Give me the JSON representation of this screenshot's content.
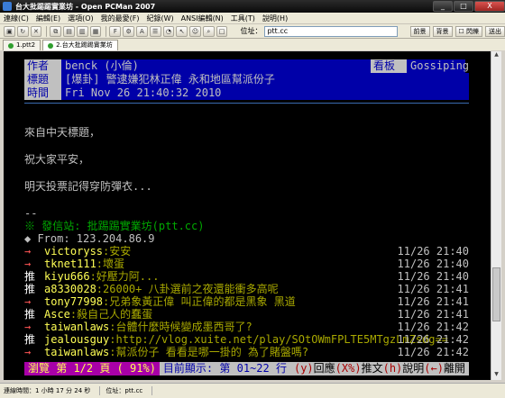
{
  "window": {
    "title": "台大批踢踢實業坊 - Open PCMan 2007",
    "controls": [
      "_",
      "□",
      "X"
    ]
  },
  "menu": [
    "連線(C)",
    "編輯(E)",
    "選項(O)",
    "我的最愛(F)",
    "紀錄(W)",
    "ANSI編輯(N)",
    "工具(T)",
    "說明(H)"
  ],
  "toolbar": {
    "address_label": "位址：",
    "address_value": "ptt.cc",
    "front_label": "前景",
    "back_label": "背景",
    "flash_label": "閃爍",
    "send_label": "送出"
  },
  "tabs": [
    {
      "label": "1.ptt2"
    },
    {
      "label": "2.台大批踢踢實業坊"
    }
  ],
  "article": {
    "author_key": "作者",
    "author": "benck (小倫)",
    "board_key": "看板",
    "board": "Gossiping",
    "title_key": "標題",
    "title": "[爆卦] 警逮嫌犯林正偉 永和地區幫派份子",
    "time_key": "時間",
    "time": "Fri Nov 26 21:40:32 2010",
    "body": [
      "來自中天標題，",
      "祝大家平安，",
      "明天投票記得穿防彈衣..."
    ],
    "signature_dashes": "--",
    "origin_line": "※ 發信站: 批踢踢實業坊(ptt.cc)",
    "from_line": "◆ From: 123.204.86.9"
  },
  "pushes": [
    {
      "tag": "→",
      "user": "victoryss",
      "content": ":安安",
      "time": "11/26 21:40"
    },
    {
      "tag": "→",
      "user": "tknet111",
      "content": ":壞蛋",
      "time": "11/26 21:40"
    },
    {
      "tag": "推",
      "user": "kiyu666",
      "content": ":好壓力阿...",
      "time": "11/26 21:40"
    },
    {
      "tag": "推",
      "user": "a8330028",
      "content": ":26000+ 八卦選前之夜還能衝多高呢",
      "time": "11/26 21:41"
    },
    {
      "tag": "→",
      "user": "tony77998",
      "content": ":兄弟象黃正偉  叫正偉的都是黑象  黑道",
      "time": "11/26 21:41"
    },
    {
      "tag": "推",
      "user": "Asce",
      "content": ":殺自己人的蠢蛋",
      "time": "11/26 21:41"
    },
    {
      "tag": "→",
      "user": "taiwanlaws",
      "content": ":台體什麼時候變成墨西哥了?",
      "time": "11/26 21:42"
    },
    {
      "tag": "推",
      "user": "jealousguy",
      "content": ":http://vlog.xuite.net/play/SOtOWmFPLTE5MTgzLmZsdg==",
      "time": "11/26 21:42"
    },
    {
      "tag": "→",
      "user": "taiwanlaws",
      "content": ":幫派份子 看看是哪一掛的 為了賭盤嗎?",
      "time": "11/26 21:42"
    }
  ],
  "footer": {
    "browse": "瀏覽 第 1/2 頁 ( 91%)",
    "showing": "目前顯示: 第 01~22 行",
    "hint_y": "(y)",
    "hint_y_label": "回應",
    "hint_x": "(X%)",
    "hint_x_label": "推文",
    "hint_h": "(h)",
    "hint_h_label": "說明",
    "hint_left": "(←)",
    "hint_left_label": "離開"
  },
  "statusbar": {
    "conn_time": "連線時間：1 小時 17 分 24 秒",
    "address": "位址：ptt.cc"
  }
}
